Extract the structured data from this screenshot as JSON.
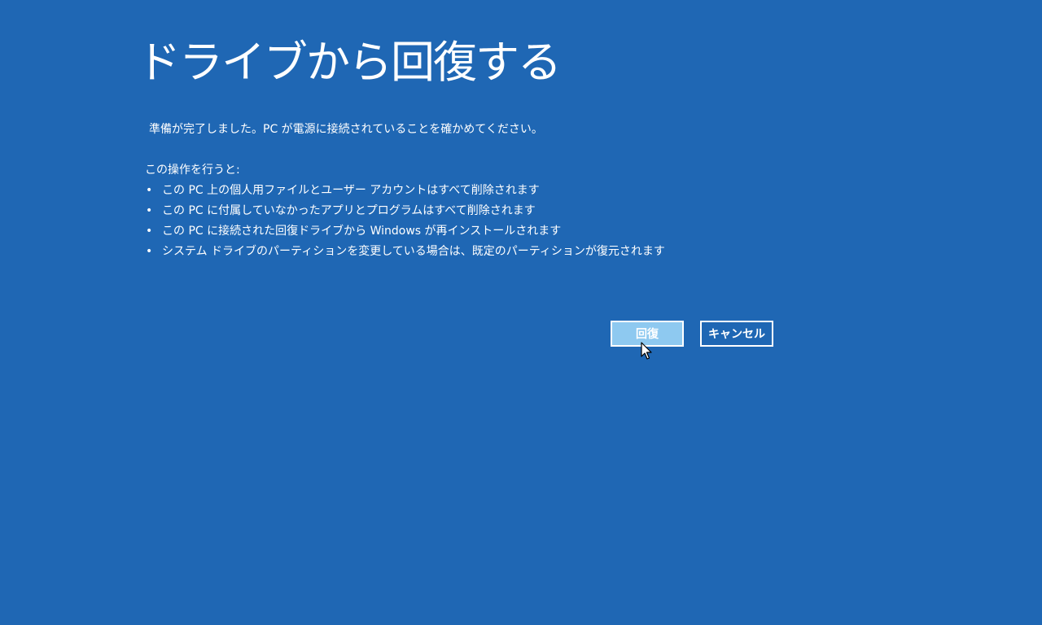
{
  "title": "ドライブから回復する",
  "ready_message": "準備が完了しました。PC が電源に接続されていることを確かめてください。",
  "intro": "この操作を行うと:",
  "effects": [
    "この PC 上の個人用ファイルとユーザー アカウントはすべて削除されます",
    "この PC に付属していなかったアプリとプログラムはすべて削除されます",
    "この PC に接続された回復ドライブから Windows が再インストールされます",
    "システム ドライブのパーティションを変更している場合は、既定のパーティションが復元されます"
  ],
  "bullet": "•",
  "buttons": {
    "recover": "回復",
    "cancel": "キャンセル"
  },
  "colors": {
    "background": "#1f67b4",
    "recover_button_fill": "#8ec9f0",
    "text": "#ffffff"
  },
  "icons": {
    "cursor": "arrow-cursor-icon"
  }
}
